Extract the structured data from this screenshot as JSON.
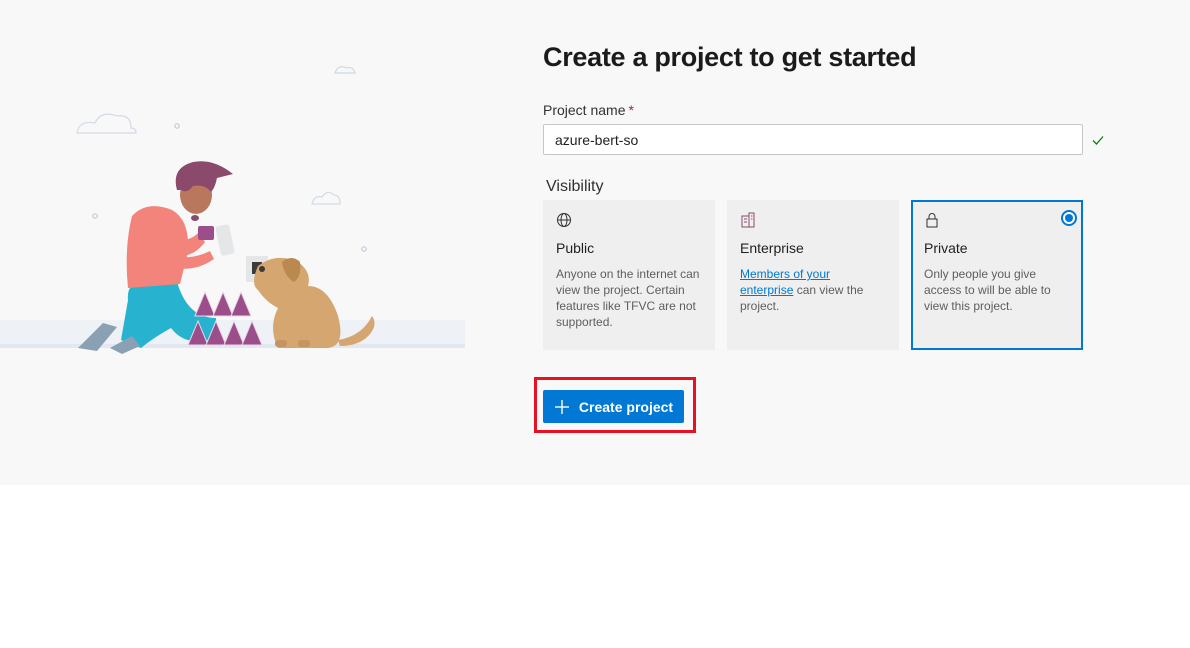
{
  "page": {
    "title": "Create a project to get started",
    "illustration_alt": "person-building-card-house-with-dog"
  },
  "form": {
    "project_name_label": "Project name",
    "required_marker": "*",
    "project_name_value": "azure-bert-so",
    "visibility_label": "Visibility"
  },
  "visibility": {
    "public": {
      "icon": "globe-icon",
      "title": "Public",
      "description": "Anyone on the internet can view the project. Certain features like TFVC are not supported."
    },
    "enterprise": {
      "icon": "building-icon",
      "title": "Enterprise",
      "link_text": "Members of your enterprise",
      "description_rest": "can view the project."
    },
    "private": {
      "icon": "lock-icon",
      "title": "Private",
      "description": "Only people you give access to will be able to view this project.",
      "selected": true
    }
  },
  "actions": {
    "create_label": "Create project",
    "create_icon": "plus-icon"
  },
  "colors": {
    "accent": "#0078d4",
    "highlight": "#e81123",
    "panel_bg": "#f8f8f8"
  }
}
